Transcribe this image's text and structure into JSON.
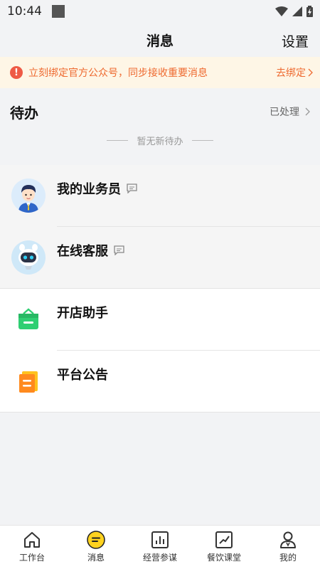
{
  "status_bar": {
    "time": "10:44"
  },
  "header": {
    "title": "消息",
    "settings_label": "设置"
  },
  "banner": {
    "text": "立刻绑定官方公众号，同步接收重要消息",
    "link_label": "去绑定",
    "accent_color": "#ee6a30"
  },
  "todo": {
    "title": "待办",
    "processed_label": "已处理",
    "empty_text": "暂无新待办"
  },
  "messages": [
    {
      "name": "我的业务员",
      "icon": "salesman-avatar-icon",
      "has_chat_badge": true
    },
    {
      "name": "在线客服",
      "icon": "robot-avatar-icon",
      "has_chat_badge": true
    },
    {
      "name": "开店助手",
      "icon": "shop-bag-icon",
      "has_chat_badge": false
    },
    {
      "name": "平台公告",
      "icon": "announcement-icon",
      "has_chat_badge": false
    }
  ],
  "tab_bar": {
    "tabs": [
      {
        "label": "工作台",
        "icon": "home-icon"
      },
      {
        "label": "消息",
        "icon": "message-icon",
        "active": true
      },
      {
        "label": "经营参谋",
        "icon": "bar-chart-icon"
      },
      {
        "label": "餐饮课堂",
        "icon": "trend-chart-icon"
      },
      {
        "label": "我的",
        "icon": "person-icon"
      }
    ],
    "active_color": "#ffd21e"
  }
}
